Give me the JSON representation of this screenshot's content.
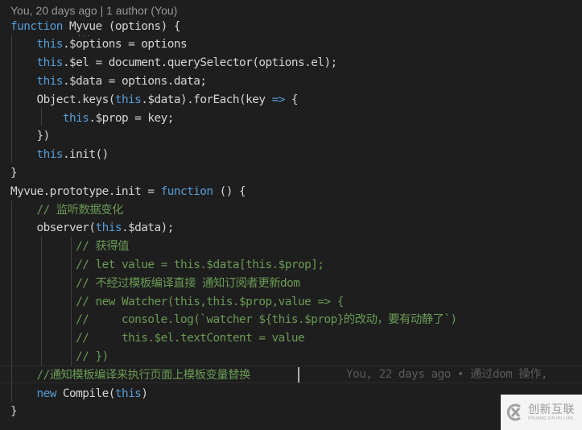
{
  "editor": {
    "codelens": "You, 20 days ago | 1 author (You)",
    "lines": [
      [
        {
          "t": "function",
          "c": "kw"
        },
        {
          "t": " Myvue (options) {",
          "c": ""
        }
      ],
      [
        {
          "t": "    ",
          "c": ""
        },
        {
          "t": "this",
          "c": "kw"
        },
        {
          "t": ".$options = options",
          "c": ""
        }
      ],
      [
        {
          "t": "    ",
          "c": ""
        },
        {
          "t": "this",
          "c": "kw"
        },
        {
          "t": ".$el = document.querySelector(options.el);",
          "c": ""
        }
      ],
      [
        {
          "t": "    ",
          "c": ""
        },
        {
          "t": "this",
          "c": "kw"
        },
        {
          "t": ".$data = options.data;",
          "c": ""
        }
      ],
      [
        {
          "t": "    Object.keys(",
          "c": ""
        },
        {
          "t": "this",
          "c": "kw"
        },
        {
          "t": ".$data).forEach(key ",
          "c": ""
        },
        {
          "t": "=>",
          "c": "kw"
        },
        {
          "t": " {",
          "c": ""
        }
      ],
      [
        {
          "t": "        ",
          "c": ""
        },
        {
          "t": "this",
          "c": "kw"
        },
        {
          "t": ".$prop = key;",
          "c": ""
        }
      ],
      [
        {
          "t": "    })",
          "c": ""
        }
      ],
      [
        {
          "t": "    ",
          "c": ""
        },
        {
          "t": "this",
          "c": "kw"
        },
        {
          "t": ".init()",
          "c": ""
        }
      ],
      [
        {
          "t": "}",
          "c": ""
        }
      ],
      [
        {
          "t": "Myvue.prototype.init = ",
          "c": ""
        },
        {
          "t": "function",
          "c": "kw"
        },
        {
          "t": " () {",
          "c": ""
        }
      ],
      [
        {
          "t": "    ",
          "c": ""
        },
        {
          "t": "// 监听数据变化",
          "c": "cm"
        }
      ],
      [
        {
          "t": "    observer(",
          "c": ""
        },
        {
          "t": "this",
          "c": "kw"
        },
        {
          "t": ".$data);",
          "c": ""
        }
      ],
      [
        {
          "t": "          ",
          "c": ""
        },
        {
          "t": "// 获得值",
          "c": "cm"
        }
      ],
      [
        {
          "t": "          ",
          "c": ""
        },
        {
          "t": "// let value = this.$data[this.$prop];",
          "c": "cm"
        }
      ],
      [
        {
          "t": "          ",
          "c": ""
        },
        {
          "t": "// 不经过模板编译直接 通知订阅者更新dom",
          "c": "cm"
        }
      ],
      [
        {
          "t": "          ",
          "c": ""
        },
        {
          "t": "// new Watcher(this,this.$prop,value => {",
          "c": "cm"
        }
      ],
      [
        {
          "t": "          ",
          "c": ""
        },
        {
          "t": "//     console.log(`watcher ${this.$prop}的改动，要有动静了`)",
          "c": "cm"
        }
      ],
      [
        {
          "t": "          ",
          "c": ""
        },
        {
          "t": "//     this.$el.textContent = value",
          "c": "cm"
        }
      ],
      [
        {
          "t": "          ",
          "c": ""
        },
        {
          "t": "// })",
          "c": "cm"
        }
      ],
      [
        {
          "t": "    ",
          "c": ""
        },
        {
          "t": "//通知模板编译来执行页面上模板变量替换",
          "c": "cm"
        }
      ],
      [
        {
          "t": "    ",
          "c": ""
        },
        {
          "t": "new",
          "c": "kw"
        },
        {
          "t": " Compile(",
          "c": ""
        },
        {
          "t": "this",
          "c": "kw"
        },
        {
          "t": ")",
          "c": ""
        }
      ],
      [
        {
          "t": "}",
          "c": ""
        }
      ]
    ],
    "blame": "You, 22 days ago • 通过dom 操作,"
  },
  "watermark": {
    "name_cn": "创新互联",
    "name_en": "CHUANG XIN HU LIAN"
  }
}
